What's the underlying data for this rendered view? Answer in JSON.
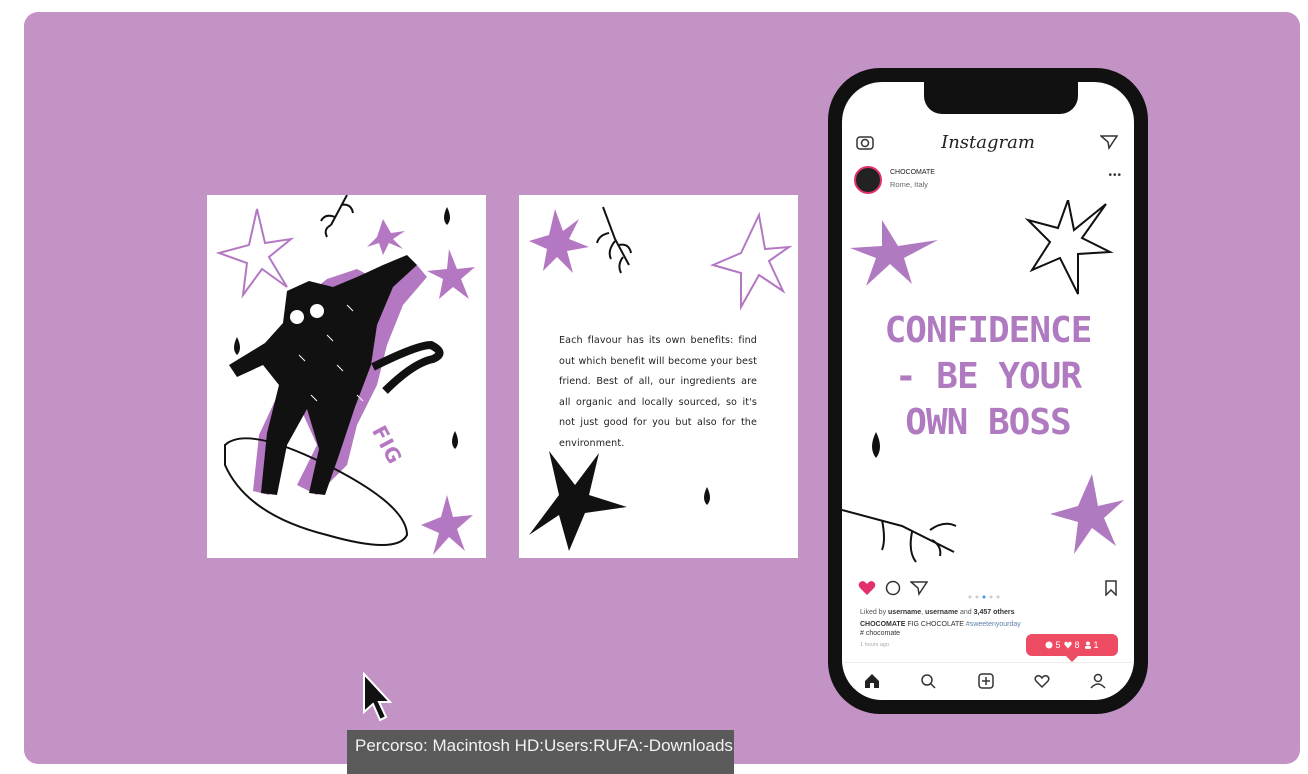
{
  "card_text": "Each flavour has its own benefits: find out which benefit will become your best friend. Best of all, our ingredients are all organic and locally sourced, so it's not just good for you but also for the environment.",
  "fig_label": "FIG",
  "phone": {
    "app_title": "Instagram",
    "account_name": "CHOCOMATE",
    "account_location": "Rome, Italy",
    "more_label": "•••",
    "headline_lines": [
      "CONFIDENCE",
      "- BE YOUR",
      "OWN BOSS"
    ],
    "likes_prefix": "Liked by ",
    "likes_user1": "username",
    "likes_user2": "username",
    "likes_mid": " and ",
    "likes_count": "3,457 others",
    "caption_account": "CHOCOMATE",
    "caption_text": " FIG CHOCOLATE ",
    "caption_hashtag": "#sweetenyourday",
    "hashtag_line": "# chocomate",
    "time_label": "1 hours ago",
    "notif_comments": "5",
    "notif_likes": "8",
    "notif_follows": "1"
  },
  "path_label": "Percorso: Macintosh HD:Users:RUFA:-Downloads:MEZZO:Advertising_Prof.",
  "colors": {
    "background": "#c493c6",
    "accent_purple": "#b07ac1",
    "notif_red": "#ee4c63",
    "heart_red": "#e1306c"
  }
}
